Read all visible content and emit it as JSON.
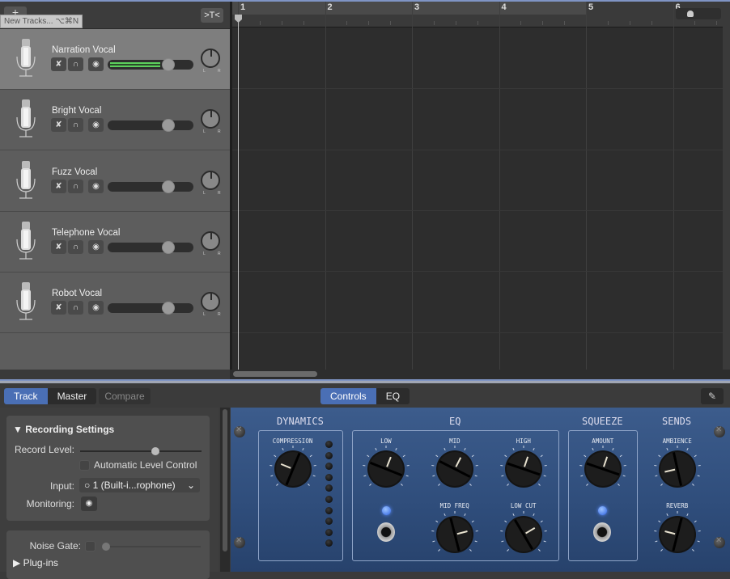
{
  "header": {
    "add_track_label": "+",
    "tooltip": "New Tracks...   ⌥⌘N",
    "catch_label": ">T<"
  },
  "tracks": [
    {
      "name": "Narration Vocal",
      "selected": true,
      "volume": 0.72,
      "level_meter": 0.62,
      "pan": 0
    },
    {
      "name": "Bright Vocal",
      "selected": false,
      "volume": 0.72,
      "pan": 0
    },
    {
      "name": "Fuzz Vocal",
      "selected": false,
      "volume": 0.72,
      "pan": 0
    },
    {
      "name": "Telephone Vocal",
      "selected": false,
      "volume": 0.72,
      "pan": 0
    },
    {
      "name": "Robot Vocal",
      "selected": false,
      "volume": 0.72,
      "pan": 0
    }
  ],
  "track_buttons": {
    "mute": "mute-icon",
    "solo": "headphones-icon",
    "monitor": "monitor-icon"
  },
  "pan_labels": "L R",
  "ruler": {
    "bars": [
      "1",
      "2",
      "3",
      "4",
      "5",
      "6"
    ],
    "cycle_region_end_bar": 5
  },
  "bottom": {
    "tabs_left": [
      {
        "label": "Track",
        "active": true
      },
      {
        "label": "Master",
        "active": false
      }
    ],
    "compare_label": "Compare",
    "tabs_center": [
      {
        "label": "Controls",
        "active": true
      },
      {
        "label": "EQ",
        "active": false
      }
    ],
    "pencil_icon": "pencil-icon"
  },
  "inspector": {
    "recording_settings": "Recording Settings",
    "record_level_label": "Record Level:",
    "record_level_value": 0.62,
    "auto_level_label": "Automatic Level Control",
    "auto_level_checked": false,
    "input_label": "Input:",
    "input_value": "1  (Built-i...rophone)",
    "monitoring_label": "Monitoring:",
    "noise_gate_label": "Noise Gate:",
    "noise_gate_checked": false,
    "noise_gate_value": 0.0,
    "plugins_label": "Plug-ins"
  },
  "rack": {
    "sections": {
      "dynamics": "DYNAMICS",
      "eq": "EQ",
      "squeeze": "SQUEEZE",
      "sends": "SENDS"
    },
    "knobs": {
      "compression": {
        "label": "COMPRESSION",
        "value": 0.25
      },
      "low": {
        "label": "LOW",
        "value": 0.58
      },
      "mid": {
        "label": "MID",
        "value": 0.6
      },
      "high": {
        "label": "HIGH",
        "value": 0.57
      },
      "mid_freq": {
        "label": "MID FREQ",
        "value": 0.78
      },
      "low_cut": {
        "label": "LOW CUT",
        "value": 0.72
      },
      "amount": {
        "label": "AMOUNT",
        "value": 0.57
      },
      "ambience": {
        "label": "AMBIENCE",
        "value": 0.12
      },
      "reverb": {
        "label": "REVERB",
        "value": 0.22
      }
    },
    "eq_switch_on": true,
    "squeeze_switch_on": true,
    "compression_meter_leds": 10
  }
}
